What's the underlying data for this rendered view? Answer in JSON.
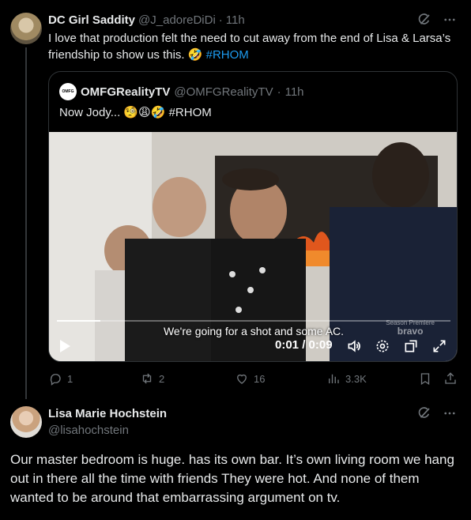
{
  "post1": {
    "author_name": "DC Girl Saddity",
    "author_handle": "@J_adoreDiDi",
    "separator": "·",
    "time": "11h",
    "text_before": "I love that production felt the need to cut away from the end of Lisa & Larsa’s friendship to show us this. 🤣 ",
    "hashtag": "#RHOM",
    "quote": {
      "author_name": "OMFGRealityTV",
      "author_handle": "@OMFGRealityTV",
      "separator": "·",
      "time": "11h",
      "text": "Now Jody... 🧐😩🤣 #RHOM",
      "avatar_text": "OMFG",
      "video": {
        "subtitle": "We're going for a shot and some AC.",
        "time_display": "0:01 / 0:09",
        "watermark_line1": "Season Premiere",
        "watermark_line2": "bravo",
        "progress": 0.11
      }
    },
    "actions": {
      "replies": "1",
      "reposts": "2",
      "likes": "16",
      "views": "3.3K"
    }
  },
  "post2": {
    "author_name": "Lisa Marie Hochstein",
    "author_handle": "@lisahochstein",
    "text": "Our master bedroom is huge. has its own bar. It’s own living room we hang out in there all the time with friends They were hot. And none of them wanted to be around that embarrassing argument on tv."
  },
  "colors": {
    "background": "#000000",
    "text": "#e7e9ea",
    "muted": "#71767b",
    "accent": "#1d9bf0",
    "border": "#2f3336"
  },
  "icons": {
    "grok": "grok-icon",
    "more": "more-icon",
    "reply": "reply-icon",
    "repost": "repost-icon",
    "like": "like-icon",
    "views": "views-icon",
    "bookmark": "bookmark-icon",
    "share": "share-icon"
  }
}
